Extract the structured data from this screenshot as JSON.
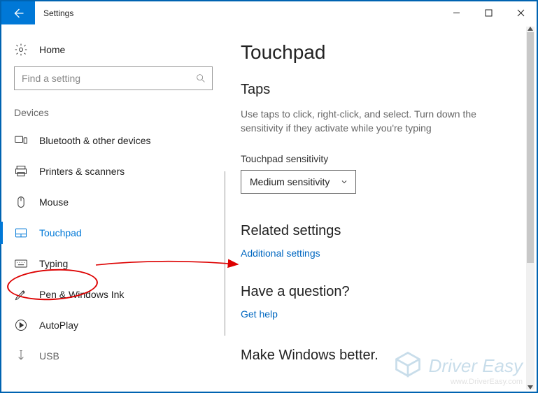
{
  "window": {
    "title": "Settings"
  },
  "sidebar": {
    "home_label": "Home",
    "search_placeholder": "Find a setting",
    "section_label": "Devices",
    "items": [
      {
        "label": "Bluetooth & other devices"
      },
      {
        "label": "Printers & scanners"
      },
      {
        "label": "Mouse"
      },
      {
        "label": "Touchpad"
      },
      {
        "label": "Typing"
      },
      {
        "label": "Pen & Windows Ink"
      },
      {
        "label": "AutoPlay"
      },
      {
        "label": "USB"
      }
    ]
  },
  "main": {
    "title": "Touchpad",
    "taps": {
      "heading": "Taps",
      "description": "Use taps to click, right-click, and select. Turn down the sensitivity if they activate while you're typing",
      "sensitivity_label": "Touchpad sensitivity",
      "sensitivity_value": "Medium sensitivity"
    },
    "related": {
      "heading": "Related settings",
      "link": "Additional settings"
    },
    "question": {
      "heading": "Have a question?",
      "link": "Get help"
    },
    "feedback_heading": "Make Windows better."
  },
  "watermark": {
    "brand": "Driver Easy",
    "url": "www.DriverEasy.com"
  }
}
